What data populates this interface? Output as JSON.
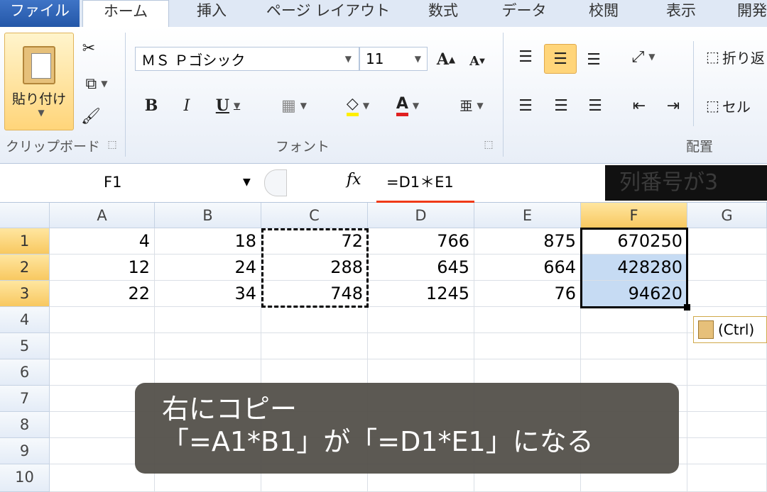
{
  "tabs": [
    "ファイル",
    "ホーム",
    "挿入",
    "ページ レイアウト",
    "数式",
    "データ",
    "校閲",
    "表示",
    "開発"
  ],
  "ribbon": {
    "clipboard": {
      "paste_label": "貼り付け",
      "group_label": "クリップボード"
    },
    "font": {
      "font_name": "ＭＳ Ｐゴシック",
      "font_size": "11",
      "bold": "B",
      "italic": "I",
      "underline": "U",
      "font_color": "A",
      "group_label": "フォント"
    },
    "alignment": {
      "wrap_label": "折り返",
      "merge_label": "セル",
      "group_label": "配置"
    }
  },
  "formula_bar": {
    "name_box": "F1",
    "fx": "fx",
    "formula": "=D1＊E1",
    "overlay_text": "列番号が3"
  },
  "grid": {
    "columns": [
      "A",
      "B",
      "C",
      "D",
      "E",
      "F",
      "G"
    ],
    "rows": [
      "1",
      "2",
      "3",
      "4",
      "5",
      "6",
      "7",
      "8",
      "9",
      "10"
    ],
    "cells": [
      [
        "4",
        "18",
        "72",
        "766",
        "875",
        "670250"
      ],
      [
        "12",
        "24",
        "288",
        "645",
        "664",
        "428280"
      ],
      [
        "22",
        "34",
        "748",
        "1245",
        "76",
        "94620"
      ]
    ]
  },
  "paste_options": {
    "label": "(Ctrl)"
  },
  "caption": {
    "line1": "右にコピー",
    "line2": "「=A1*B1」が「=D1*E1」になる"
  },
  "colors": {
    "accent": "#f8c860",
    "selection": "#c6dbf3",
    "red": "#ef3a18"
  }
}
